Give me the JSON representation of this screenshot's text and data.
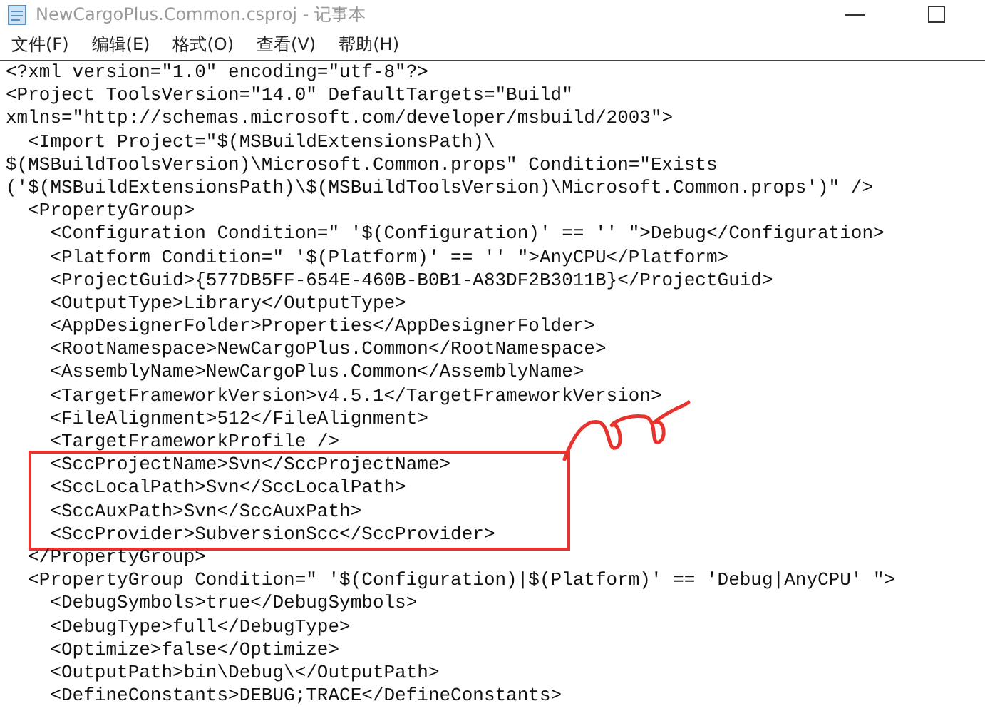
{
  "window": {
    "title": "NewCargoPlus.Common.csproj - 记事本"
  },
  "menu": [
    {
      "label": "文件(F)"
    },
    {
      "label": "编辑(E)"
    },
    {
      "label": "格式(O)"
    },
    {
      "label": "查看(V)"
    },
    {
      "label": "帮助(H)"
    }
  ],
  "editor": {
    "groups": [
      {
        "boxed": false,
        "lines": [
          "<?xml version=\"1.0\" encoding=\"utf-8\"?>",
          "<Project ToolsVersion=\"14.0\" DefaultTargets=\"Build\"",
          "xmlns=\"http://schemas.microsoft.com/developer/msbuild/2003\">",
          "  <Import Project=\"$(MSBuildExtensionsPath)\\",
          "$(MSBuildToolsVersion)\\Microsoft.Common.props\" Condition=\"Exists",
          "('$(MSBuildExtensionsPath)\\$(MSBuildToolsVersion)\\Microsoft.Common.props')\" />",
          "  <PropertyGroup>",
          "    <Configuration Condition=\" '$(Configuration)' == '' \">Debug</Configuration>",
          "    <Platform Condition=\" '$(Platform)' == '' \">AnyCPU</Platform>",
          "    <ProjectGuid>{577DB5FF-654E-460B-B0B1-A83DF2B3011B}</ProjectGuid>",
          "    <OutputType>Library</OutputType>",
          "    <AppDesignerFolder>Properties</AppDesignerFolder>",
          "    <RootNamespace>NewCargoPlus.Common</RootNamespace>",
          "    <AssemblyName>NewCargoPlus.Common</AssemblyName>",
          "    <TargetFrameworkVersion>v4.5.1</TargetFrameworkVersion>",
          "    <FileAlignment>512</FileAlignment>",
          "    <TargetFrameworkProfile />"
        ]
      },
      {
        "boxed": true,
        "lines": [
          "    <SccProjectName>Svn</SccProjectName>",
          "    <SccLocalPath>Svn</SccLocalPath>",
          "    <SccAuxPath>Svn</SccAuxPath>",
          "    <SccProvider>SubversionScc</SccProvider>"
        ]
      },
      {
        "boxed": false,
        "lines": [
          "  </PropertyGroup>",
          "  <PropertyGroup Condition=\" '$(Configuration)|$(Platform)' == 'Debug|AnyCPU' \">",
          "    <DebugSymbols>true</DebugSymbols>",
          "    <DebugType>full</DebugType>",
          "    <Optimize>false</Optimize>",
          "    <OutputPath>bin\\Debug\\</OutputPath>",
          "    <DefineConstants>DEBUG;TRACE</DefineConstants>"
        ]
      }
    ]
  }
}
